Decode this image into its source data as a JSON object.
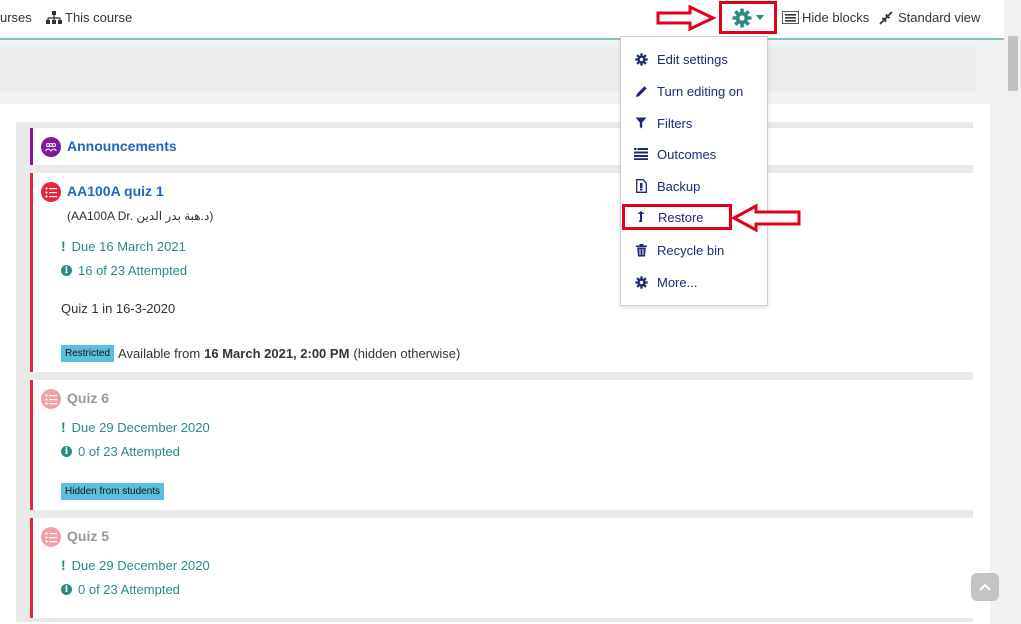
{
  "navbar": {
    "courses_label": "urses",
    "this_course_label": "This course",
    "hide_blocks_label": "Hide blocks",
    "standard_view_label": "Standard view"
  },
  "dropdown": {
    "items": [
      {
        "label": "Edit settings",
        "icon": "gear-icon"
      },
      {
        "label": "Turn editing on",
        "icon": "pencil-icon"
      },
      {
        "label": "Filters",
        "icon": "filter-icon"
      },
      {
        "label": "Outcomes",
        "icon": "outcomes-icon"
      },
      {
        "label": "Backup",
        "icon": "backup-file-icon"
      },
      {
        "label": "Restore",
        "icon": "restore-arrow-icon"
      },
      {
        "label": "Recycle bin",
        "icon": "trash-icon"
      },
      {
        "label": "More...",
        "icon": "gear-icon"
      }
    ]
  },
  "activities": {
    "announcements": {
      "title": "Announcements"
    },
    "quiz1": {
      "title": "AA100A quiz 1",
      "subtitle": "(AA100A Dr. د.هبة بدر الدين)",
      "due": "Due 16 March 2021",
      "attempted": "16 of 23 Attempted",
      "description": "Quiz 1  in 16-3-2020",
      "badge": "Restricted",
      "restriction_prefix": "Available from",
      "restriction_date": "16 March 2021, 2:00 PM",
      "restriction_suffix": "(hidden otherwise)"
    },
    "quiz6": {
      "title": "Quiz 6",
      "due": "Due 29 December 2020",
      "attempted": "0 of 23 Attempted",
      "badge": "Hidden from students"
    },
    "quiz5": {
      "title": "Quiz 5",
      "due": "Due 29 December 2020",
      "attempted": "0 of 23 Attempted"
    }
  },
  "colors": {
    "accent_teal": "#2a8a86",
    "annotation_red": "#e0001b",
    "link_blue": "#1a67c4",
    "menu_text": "#1e2a78",
    "quiz_red": "#e0283a",
    "forum_purple": "#7d1a9e",
    "badge_cyan": "#5bc0de"
  }
}
